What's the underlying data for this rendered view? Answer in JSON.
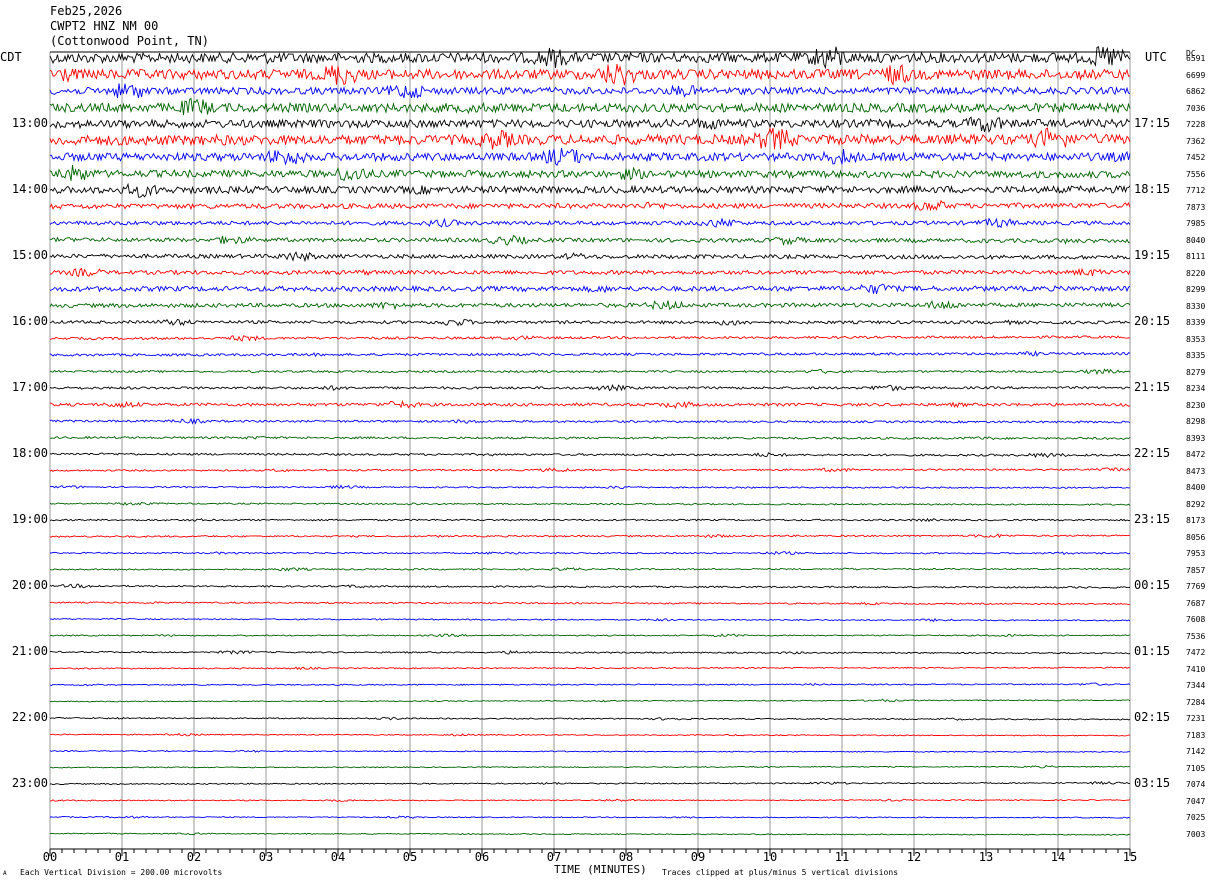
{
  "header": {
    "date": "Feb25,2026",
    "station": "CWPT2 HNZ NM 00",
    "location": "(Cottonwood Point, TN)"
  },
  "left_tz": "CDT",
  "right_tz": "UTC",
  "dc_header": "DC",
  "footer": {
    "xlabel": "TIME (MINUTES)",
    "scale_note": "Each Vertical Division =  200.00 microvolts",
    "clip_note": "Traces clipped at plus/minus 5 vertical divisions",
    "mark": "A"
  },
  "colors": {
    "black": "#000000",
    "red": "#ff0000",
    "blue": "#0000ff",
    "green": "#006400",
    "grid": "#808080"
  },
  "chart_data": {
    "type": "line",
    "title": "",
    "xlabel": "TIME (MINUTES)",
    "x_ticks": [
      "00",
      "01",
      "02",
      "03",
      "04",
      "05",
      "06",
      "07",
      "08",
      "09",
      "10",
      "11",
      "12",
      "13",
      "14",
      "15"
    ],
    "xlim": [
      0,
      15
    ],
    "traces_per_hour": 4,
    "trace_color_cycle": [
      "black",
      "red",
      "blue",
      "green"
    ],
    "hour_labels_left": [
      "13:00",
      "14:00",
      "15:00",
      "16:00",
      "17:00",
      "18:00",
      "19:00",
      "20:00",
      "21:00",
      "22:00",
      "23:00"
    ],
    "hour_labels_right": [
      "17:15",
      "18:15",
      "19:15",
      "20:15",
      "21:15",
      "22:15",
      "23:15",
      "00:15",
      "01:15",
      "02:15",
      "03:15"
    ],
    "dc_offsets": [
      "6591",
      "6699",
      "6862",
      "7036",
      "7228",
      "7362",
      "7452",
      "7556",
      "7712",
      "7873",
      "7985",
      "8040",
      "8111",
      "8220",
      "8299",
      "8330",
      "8339",
      "8353",
      "8335",
      "8279",
      "8234",
      "8230",
      "8298",
      "8393",
      "8472",
      "8473",
      "8400",
      "8292",
      "8173",
      "8056",
      "7953",
      "7857",
      "7769",
      "7687",
      "7608",
      "7536",
      "7472",
      "7410",
      "7344",
      "7284",
      "7231",
      "7183",
      "7142",
      "7105",
      "7074",
      "7047",
      "7025",
      "7003"
    ],
    "trace_amplitude": [
      5,
      5,
      3.5,
      4.5,
      4,
      5,
      4,
      3.5,
      3.5,
      2.5,
      2,
      2,
      2,
      2,
      2.5,
      2,
      1.5,
      1.2,
      1.2,
      1,
      1.2,
      1.5,
      1,
      1,
      1,
      0.8,
      0.7,
      0.7,
      0.8,
      0.8,
      0.7,
      0.7,
      0.8,
      0.7,
      0.6,
      0.6,
      0.7,
      0.6,
      0.6,
      0.5,
      0.6,
      0.5,
      0.5,
      0.5,
      0.6,
      0.5,
      0.5,
      0.5
    ]
  }
}
